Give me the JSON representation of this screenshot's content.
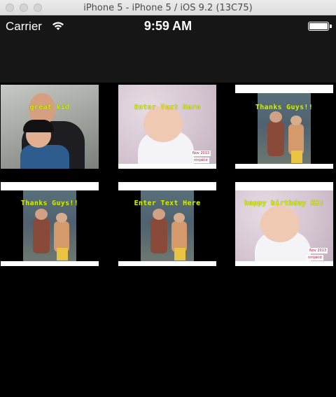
{
  "simulator": {
    "title": "iPhone 5 - iPhone 5 / iOS 9.2 (13C75)"
  },
  "status_bar": {
    "carrier": "Carrier",
    "time": "9:59 AM",
    "battery_level": 1.0
  },
  "grid": {
    "items": [
      {
        "caption": "great kid",
        "photo": "father-and-son"
      },
      {
        "caption": "Enter Text Here",
        "photo": "baby",
        "stamp": "Nov 2013",
        "stamp2": "ninjakid"
      },
      {
        "caption": "Thanks Guys!!",
        "photo": "two-children"
      },
      {
        "caption": "Thanks Guys!!",
        "photo": "two-children"
      },
      {
        "caption": "Enter Text Here",
        "photo": "two-children"
      },
      {
        "caption": "happy birthday KK!",
        "photo": "baby",
        "stamp": "Nov 2013",
        "stamp2": "ninjakid"
      }
    ]
  },
  "colors": {
    "caption": "#d4f000",
    "background": "#000000",
    "bar": "#161616"
  }
}
